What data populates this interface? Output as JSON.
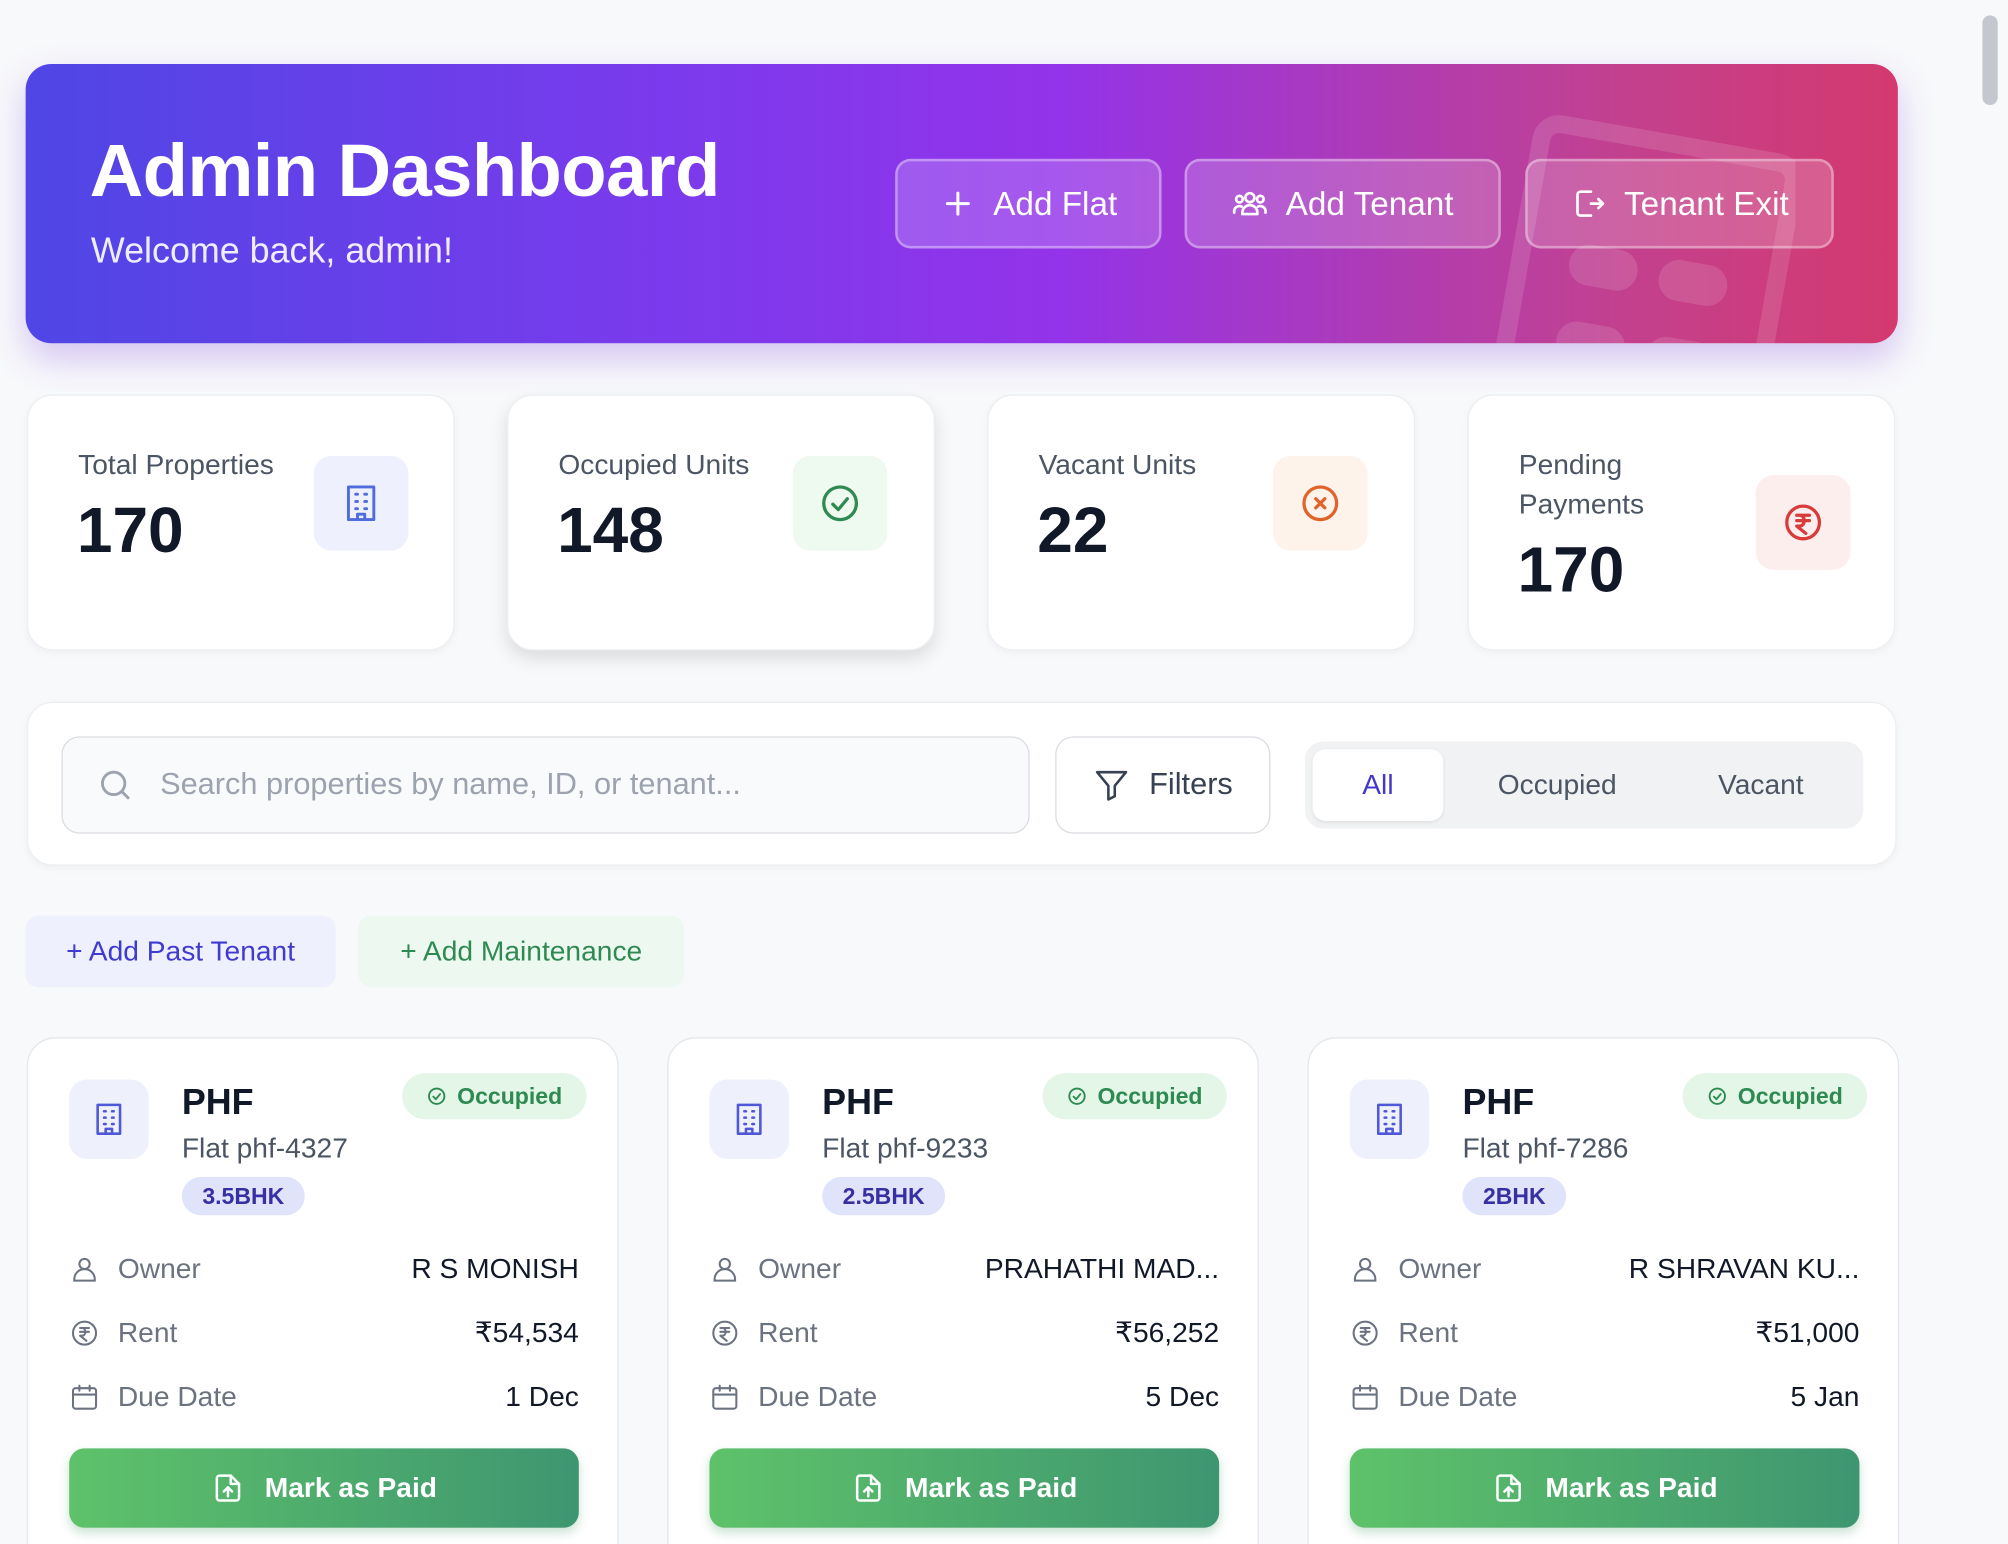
{
  "header": {
    "title": "Admin Dashboard",
    "subtitle": "Welcome back, admin!",
    "buttons": [
      {
        "label": "Add Flat",
        "icon": "plus-icon"
      },
      {
        "label": "Add Tenant",
        "icon": "users-icon"
      },
      {
        "label": "Tenant Exit",
        "icon": "logout-icon"
      }
    ]
  },
  "stats": [
    {
      "label": "Total Properties",
      "value": "170",
      "icon": "building-icon",
      "color": "#4f6bdc"
    },
    {
      "label": "Occupied Units",
      "value": "148",
      "icon": "check-circle-icon",
      "color": "#2f8a52"
    },
    {
      "label": "Vacant Units",
      "value": "22",
      "icon": "x-circle-icon",
      "color": "#e0632a"
    },
    {
      "label": "Pending Payments",
      "value": "170",
      "icon": "rupee-circle-icon",
      "color": "#d93a3a"
    }
  ],
  "search": {
    "placeholder": "Search properties by name, ID, or tenant...",
    "value": ""
  },
  "filters_label": "Filters",
  "segments": {
    "all": "All",
    "occupied": "Occupied",
    "vacant": "Vacant",
    "selected": "All"
  },
  "quick_actions": {
    "add_past_tenant": "+ Add Past Tenant",
    "add_maintenance": "+ Add Maintenance"
  },
  "labels": {
    "owner": "Owner",
    "rent": "Rent",
    "due_date": "Due Date",
    "mark_paid": "Mark as Paid"
  },
  "properties": [
    {
      "name": "PHF",
      "flat": "Flat phf-4327",
      "bhk": "3.5BHK",
      "status": "Occupied",
      "owner": "R S MONISH",
      "rent": "₹54,534",
      "due": "1 Dec"
    },
    {
      "name": "PHF",
      "flat": "Flat phf-9233",
      "bhk": "2.5BHK",
      "status": "Occupied",
      "owner": "PRAHATHI MAD...",
      "rent": "₹56,252",
      "due": "5 Dec"
    },
    {
      "name": "PHF",
      "flat": "Flat phf-7286",
      "bhk": "2BHK",
      "status": "Occupied",
      "owner": "R SHRAVAN KU...",
      "rent": "₹51,000",
      "due": "5 Jan"
    }
  ],
  "colors": {
    "accent": "#4338ca",
    "success": "#2f8a52",
    "header_gradient_start": "#4f46e5",
    "header_gradient_end": "#d4396f"
  }
}
